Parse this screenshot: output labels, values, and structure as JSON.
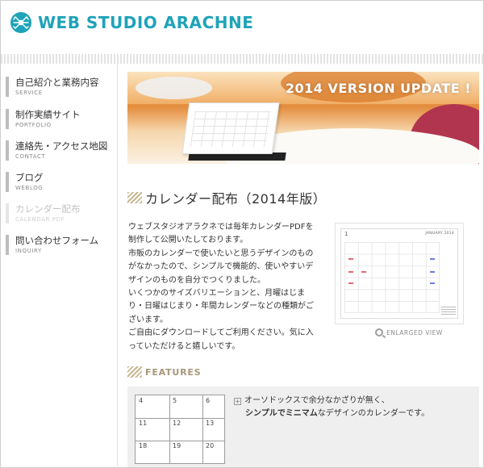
{
  "site": {
    "logo_text": "WEB STUDIO ARACHNE"
  },
  "nav": [
    {
      "jp": "自己紹介と業務内容",
      "en": "SERVICE",
      "active": true
    },
    {
      "jp": "制作実績サイト",
      "en": "PORTFOLIO",
      "active": true
    },
    {
      "jp": "連絡先・アクセス地図",
      "en": "CONTACT",
      "active": true
    },
    {
      "jp": "ブログ",
      "en": "WEBLOG",
      "active": true
    },
    {
      "jp": "カレンダー配布",
      "en": "CALENDAR PDF",
      "active": false
    },
    {
      "jp": "問い合わせフォーム",
      "en": "INQUIRY",
      "active": true
    }
  ],
  "hero": {
    "title": "2014 VERSION UPDATE !"
  },
  "section": {
    "title": "カレンダー配布（2014年版）",
    "paragraphs": [
      "ウェブスタジオアラクネでは毎年カレンダーPDFを制作して公開いたしております。",
      "市販のカレンダーで使いたいと思うデザインのものがなかったので、シンプルで機能的、使いやすいデザインのものを自分でつくりました。",
      "いくつかのサイズバリエーションと、月曜はじまり・日曜はじまり・年間カレンダーなどの種類がございます。",
      "ご自由にダウンロードしてご利用ください。気に入っていただけると嬉しいです。"
    ]
  },
  "thumbnail": {
    "month_number": "1",
    "month_label": "JANUARY 2014",
    "enlarge_label": "ENLARGED VIEW"
  },
  "features": {
    "title": "FEATURES",
    "grid_numbers": [
      "4",
      "5",
      "6",
      "11",
      "12",
      "13",
      "18",
      "19",
      "20"
    ],
    "line1": "オーソドックスで余分なかざりが無く、",
    "line2_bold": "シンプルでミニマム",
    "line2_rest": "なデザインのカレンダーです。"
  },
  "colors": {
    "brand": "#1fa3b8",
    "accent_hatch": "#c9b892",
    "features_title": "#a7977a"
  }
}
